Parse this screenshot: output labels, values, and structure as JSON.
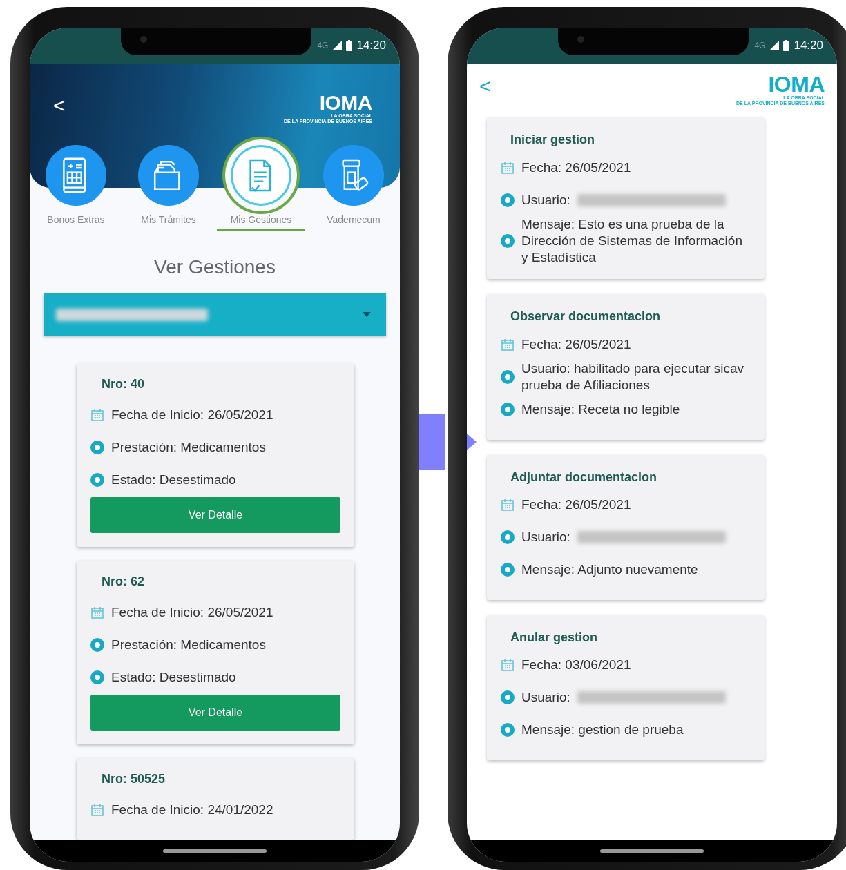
{
  "left_phone": {
    "status_bar": {
      "network": "4G",
      "time": "14:20"
    },
    "header": {
      "back": "<",
      "logo": "IOMA",
      "logo_tagline": [
        "LA OBRA SOCIAL",
        "DE LA PROVINCIA DE BUENOS AIRES"
      ]
    },
    "categories": [
      {
        "kind": "tablet",
        "label": "Bonos Extras",
        "selected": false
      },
      {
        "kind": "folder",
        "label": "Mis Trámites",
        "selected": false
      },
      {
        "kind": "document",
        "label": "Mis Gestiones",
        "selected": true
      },
      {
        "kind": "medicine",
        "label": "Vademecum",
        "selected": false
      }
    ],
    "title": "Ver Gestiones",
    "dropdown": {
      "redacted": true
    },
    "cards": [
      {
        "number": "Nro: 40",
        "rows": [
          {
            "kind": "date",
            "text": "Fecha de Inicio: 26/05/2021"
          },
          {
            "kind": "dot",
            "text": "Prestación: Medicamentos"
          },
          {
            "kind": "dot",
            "text": "Estado:  Desestimado"
          }
        ],
        "button": "Ver Detalle"
      },
      {
        "number": "Nro: 62",
        "rows": [
          {
            "kind": "date",
            "text": "Fecha de Inicio: 26/05/2021"
          },
          {
            "kind": "dot",
            "text": "Prestación: Medicamentos"
          },
          {
            "kind": "dot",
            "text": "Estado:  Desestimado"
          }
        ],
        "button": "Ver Detalle"
      },
      {
        "number": "Nro: 50525",
        "rows": [
          {
            "kind": "date",
            "text": "Fecha de Inicio: 24/01/2022"
          }
        ]
      }
    ]
  },
  "right_phone": {
    "status_bar": {
      "network": "4G",
      "time": "14:20"
    },
    "header": {
      "back": "<",
      "logo": "IOMA",
      "logo_tagline": [
        "LA OBRA SOCIAL",
        "DE LA PROVINCIA DE BUENOS AIRES"
      ]
    },
    "events": [
      {
        "title": "Iniciar gestion",
        "rows": [
          {
            "kind": "date",
            "text": "Fecha: 26/05/2021"
          },
          {
            "kind": "dot",
            "text": "Usuario:",
            "redacted": true
          },
          {
            "kind": "dot",
            "text": "Mensaje:  Esto es una prueba de la Dirección de Sistemas de Información y Estadística"
          }
        ]
      },
      {
        "title": "Observar documentacion",
        "rows": [
          {
            "kind": "date",
            "text": "Fecha: 26/05/2021"
          },
          {
            "kind": "dot",
            "text": "Usuario:  habilitado para ejecutar sicav prueba de Afiliaciones"
          },
          {
            "kind": "dot",
            "text": "Mensaje:  Receta no legible"
          }
        ]
      },
      {
        "title": "Adjuntar documentacion",
        "rows": [
          {
            "kind": "date",
            "text": "Fecha: 26/05/2021"
          },
          {
            "kind": "dot",
            "text": "Usuario:",
            "redacted": true
          },
          {
            "kind": "dot",
            "text": "Mensaje:  Adjunto nuevamente"
          }
        ]
      },
      {
        "title": "Anular gestion",
        "rows": [
          {
            "kind": "date",
            "text": "Fecha: 03/06/2021"
          },
          {
            "kind": "dot",
            "text": "Usuario:",
            "redacted": true
          },
          {
            "kind": "dot",
            "text": "Mensaje:  gestion de prueba"
          }
        ]
      }
    ]
  }
}
